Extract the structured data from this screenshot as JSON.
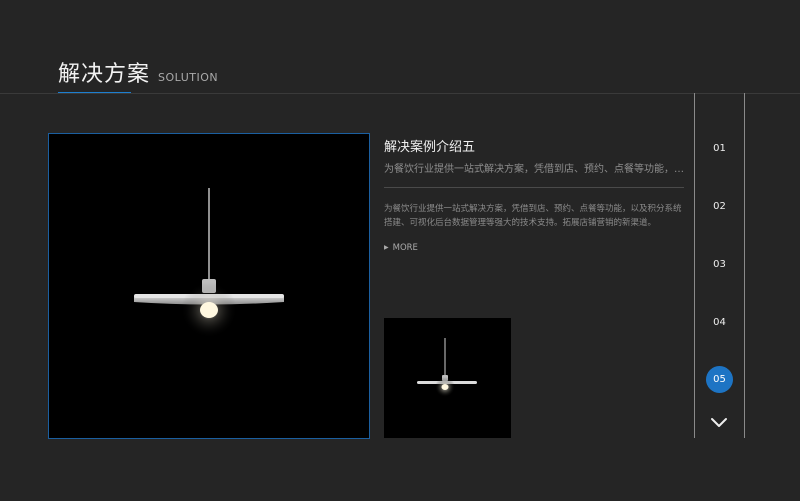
{
  "header": {
    "title": "解决方案",
    "subtitle": "SOLUTION"
  },
  "colors": {
    "accent": "#1d74c4",
    "background": "#252525",
    "image_frame_border": "#1b5fa0"
  },
  "case": {
    "title": "解决案例介绍五",
    "summary": "为餐饮行业提供一站式解决方案，凭借到店、预约、点餐等功能，以及积分系统搭建…",
    "description": "为餐饮行业提供一站式解决方案，凭借到店、预约、点餐等功能，以及积分系统搭建、可视化后台数据管理等强大的技术支持。拓展店铺营销的新渠道。",
    "more_label": "MORE",
    "more_icon": "triangle-right-icon"
  },
  "images": {
    "main_alt": "pendant lamp",
    "thumb_alt": "pendant lamp"
  },
  "pager": {
    "items": [
      "01",
      "02",
      "03",
      "04",
      "05"
    ],
    "active_index": 4,
    "next_icon": "chevron-down-icon"
  }
}
